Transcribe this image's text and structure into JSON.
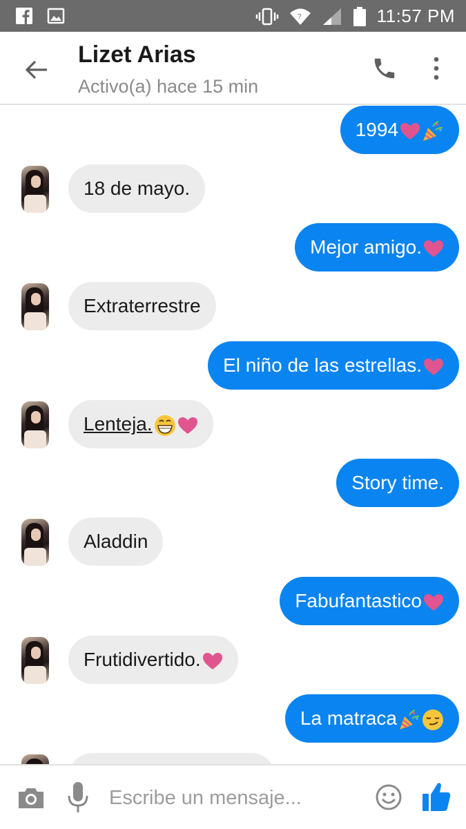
{
  "status_bar": {
    "time": "11:57 PM",
    "left_icons": [
      "facebook-icon",
      "image-icon"
    ],
    "right_icons": [
      "vibrate-icon",
      "wifi-icon",
      "signal-icon",
      "battery-icon"
    ]
  },
  "header": {
    "contact_name": "Lizet Arias",
    "contact_status": "Activo(a) hace 15 min",
    "icons": [
      "back-arrow-icon",
      "phone-icon",
      "more-vertical-icon"
    ]
  },
  "messages": [
    {
      "direction": "out",
      "text": "1994",
      "emojis": [
        "heart",
        "party-popper"
      ]
    },
    {
      "direction": "in",
      "text": "18 de mayo.",
      "emojis": []
    },
    {
      "direction": "out",
      "text": "Mejor amigo.",
      "emojis": [
        "heart"
      ]
    },
    {
      "direction": "in",
      "text": "Extraterrestre",
      "emojis": []
    },
    {
      "direction": "out",
      "text": "El niño de las estrellas.",
      "emojis": [
        "heart"
      ]
    },
    {
      "direction": "in",
      "text": "Lenteja.",
      "emojis": [
        "grin",
        "heart"
      ]
    },
    {
      "direction": "out",
      "text": "Story time.",
      "emojis": []
    },
    {
      "direction": "in",
      "text": "Aladdin",
      "emojis": []
    },
    {
      "direction": "out",
      "text": "Fabufantastico",
      "emojis": [
        "heart"
      ]
    },
    {
      "direction": "in",
      "text": "Frutidivertido.",
      "emojis": [
        "heart"
      ]
    },
    {
      "direction": "out",
      "text": "La matraca",
      "emojis": [
        "party-popper",
        "smirk"
      ]
    }
  ],
  "composer": {
    "placeholder": "Escribe un mensaje...",
    "value": "",
    "icons": [
      "camera-icon",
      "microphone-icon",
      "emoji-icon",
      "thumbs-up-icon"
    ]
  },
  "colors": {
    "outgoing_bubble": "#0a84f0",
    "incoming_bubble": "#ececec",
    "heart": "#e0558f",
    "accent": "#0a84f0",
    "status_bar": "#6b6b6b"
  }
}
